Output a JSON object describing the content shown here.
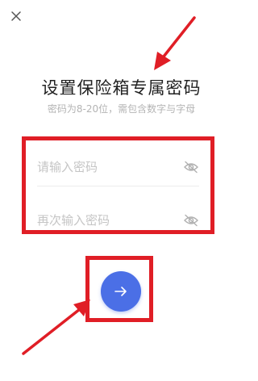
{
  "header": {
    "close_icon": "close-icon"
  },
  "title": "设置保险箱专属密码",
  "subtitle": "密码为8-20位，需包含数字与字母",
  "form": {
    "password": {
      "placeholder": "请输入密码",
      "value": ""
    },
    "confirm": {
      "placeholder": "再次输入密码",
      "value": ""
    },
    "toggle_icon": "eye-off-icon"
  },
  "next_button": {
    "icon": "arrow-right-icon"
  },
  "colors": {
    "annotation_red": "#e01e26",
    "primary_blue": "#4b6fe6",
    "placeholder": "#c5c5c5",
    "subtitle": "#b4b4b4"
  }
}
